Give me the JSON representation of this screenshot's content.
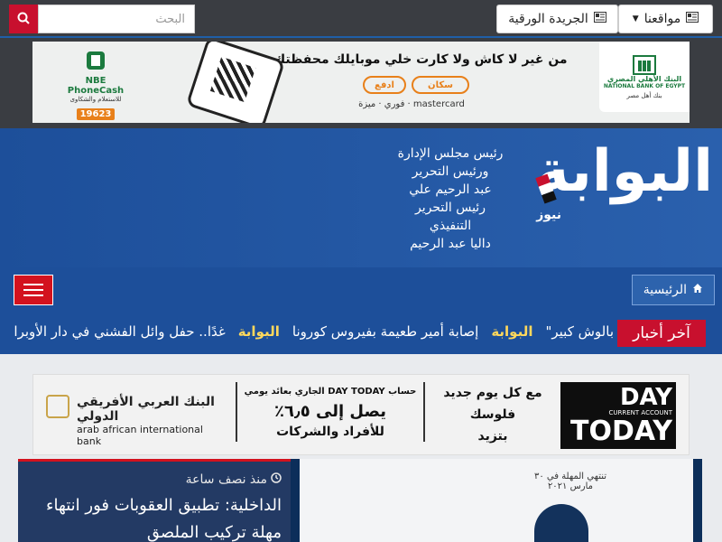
{
  "topbar": {
    "sites_label": "مواقعنا",
    "paper_label": "الجريدة الورقية",
    "search_placeholder": "البحث"
  },
  "ad_top": {
    "headline": "من غير لا كاش ولا كارت خلي موبايلك محفظتك",
    "pill_scan": "سكان",
    "pill_pay": "ادفع",
    "payments": "mastercard · فوري · ميزة",
    "bank_name": "البنك الأهلي المصري",
    "bank_name_en": "NATIONAL BANK OF EGYPT",
    "bank_tag": "بنك أهل مصر",
    "pc_brand": "NBE PhoneCash",
    "pc_number": "19623",
    "pc_sub": "للاستعلام والشكاوى"
  },
  "header": {
    "logo_text": "البوابة",
    "logo_sub": "نيوز",
    "board": [
      "رئيس مجلس الإدارة",
      "ورئيس التحرير",
      "عبد الرحيم علي",
      "رئيس التحرير",
      "التنفيذي",
      "داليا عبد الرحيم"
    ],
    "home_label": "الرئيسية"
  },
  "ticker": {
    "label": "آخر أخبار",
    "brand": "البوابة",
    "items": [
      "غدًا.. حفل وائل الفشني في دار الأوبرا",
      "إصابة أمير طعيمة بفيروس كورونا",
      "بالوش كبير\""
    ]
  },
  "ad_bank": {
    "day": "DAY",
    "current": "CURRENT ACCOUNT",
    "today": "TODAY",
    "line1": "مع كل يوم جديد",
    "line2": "فلوسك",
    "line3": "بتزيد",
    "offer1": "حساب DAY TODAY الجاري بعائد يومي",
    "offer2": "يصل إلى ٦٫٥٪",
    "offer3": "للأفراد والشركات",
    "bank_ar": "البنك العربي الأفريقي الدولي",
    "bank_en": "arab african international bank"
  },
  "news": {
    "time": "منذ نصف ساعة",
    "title": "الداخلية: تطبيق العقوبات فور انتهاء مهلة تركيب الملصق",
    "image_caption": "تنتهي المهلة في ٣٠ مارس ٢٠٢١"
  },
  "colors": {
    "brand_blue": "#1d4f9a",
    "accent_red": "#c8102e",
    "topbar": "#3a3d42"
  }
}
